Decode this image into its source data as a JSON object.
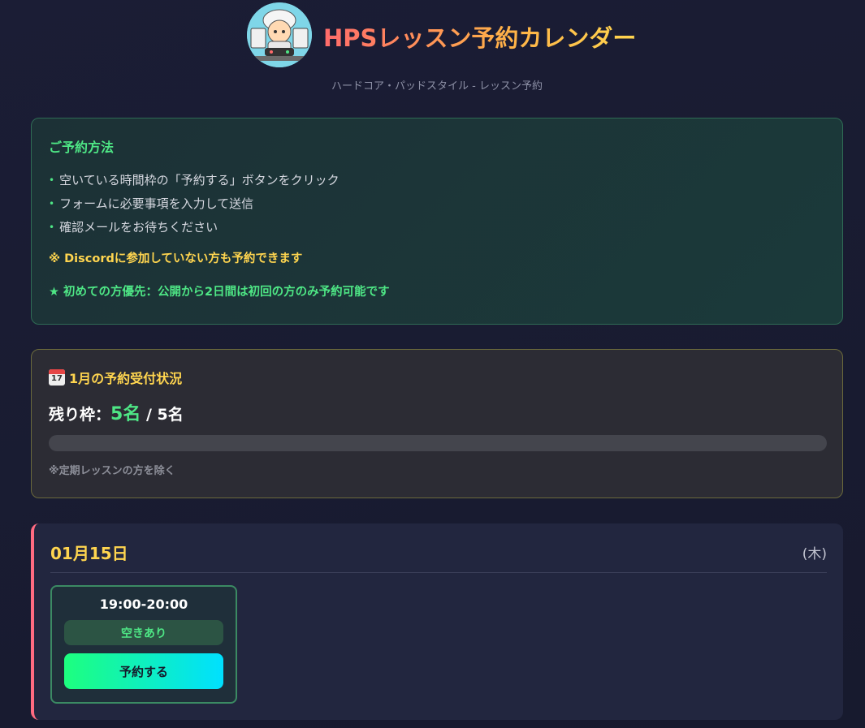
{
  "header": {
    "title": "HPSレッスン予約カレンダー",
    "subtitle": "ハードコア・パッドスタイル - レッスン予約"
  },
  "howto": {
    "title": "ご予約方法",
    "steps": [
      "空いている時間枠の「予約する」ボタンをクリック",
      "フォームに必要事項を入力して送信",
      "確認メールをお待ちください"
    ],
    "note_discord": "※ Discordに参加していない方も予約できます",
    "note_priority": "★ 初めての方優先：公開から2日間は初回の方のみ予約可能です"
  },
  "status": {
    "title": "1月の予約受付状況",
    "remaining_label": "残り枠：",
    "remaining_value": "5名",
    "total": "/ 5名",
    "filled_fraction": 0,
    "note": "※定期レッスンの方を除く"
  },
  "days": [
    {
      "date": "01月15日",
      "weekday": "(木)",
      "slots": [
        {
          "time": "19:00-20:00",
          "availability": "空きあり",
          "button_label": "予約する"
        }
      ]
    }
  ],
  "colors": {
    "accent_green": "#4ee685",
    "accent_yellow": "#ffd54f",
    "accent_red": "#ff6b81"
  },
  "icons": {
    "calendar": "calendar-icon",
    "logo": "logo-mascot"
  }
}
